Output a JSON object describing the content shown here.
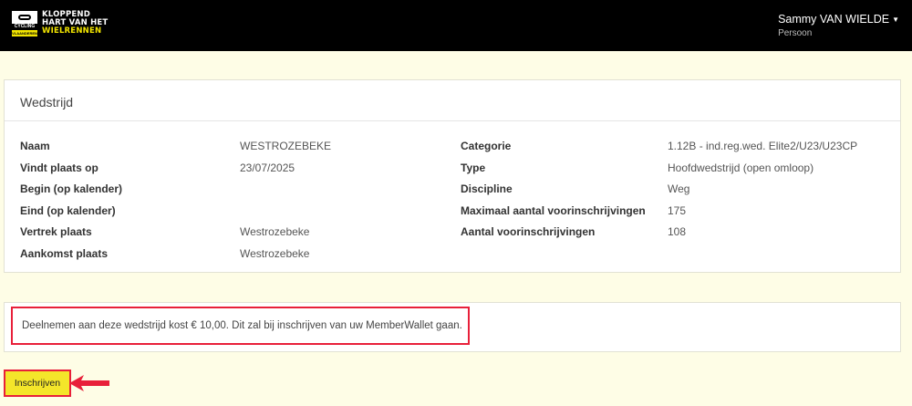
{
  "brand": {
    "line1": "KLOPPEND",
    "line2": "HART VAN HET",
    "line3": "WIELRENNEN",
    "badge_mid": "CYCLING",
    "badge_bot": "VLAANDEREN"
  },
  "user": {
    "name": "Sammy VAN WIELDE",
    "role": "Persoon"
  },
  "race": {
    "title": "Wedstrijd",
    "fields_left": [
      {
        "label": "Naam",
        "value": "WESTROZEBEKE"
      },
      {
        "label": "Vindt plaats op",
        "value": "23/07/2025"
      },
      {
        "label": "Begin (op kalender)",
        "value": ""
      },
      {
        "label": "Eind (op kalender)",
        "value": ""
      },
      {
        "label": "Vertrek plaats",
        "value": "Westrozebeke"
      },
      {
        "label": "Aankomst plaats",
        "value": "Westrozebeke"
      }
    ],
    "fields_right": [
      {
        "label": "Categorie",
        "value": "1.12B - ind.reg.wed. Elite2/U23/U23CP"
      },
      {
        "label": "Type",
        "value": "Hoofdwedstrijd (open omloop)"
      },
      {
        "label": "Discipline",
        "value": "Weg"
      },
      {
        "label": "Maximaal aantal voorinschrijvingen",
        "value": "175"
      },
      {
        "label": "Aantal voorinschrijvingen",
        "value": "108"
      }
    ]
  },
  "notice": "Deelnemen aan deze wedstrijd kost € 10,00. Dit zal bij inschrijven van uw MemberWallet gaan.",
  "actions": {
    "register_label": "Inschrijven"
  },
  "colors": {
    "highlight": "#e8203a",
    "accent": "#f4e52a",
    "background": "#fefde6"
  }
}
